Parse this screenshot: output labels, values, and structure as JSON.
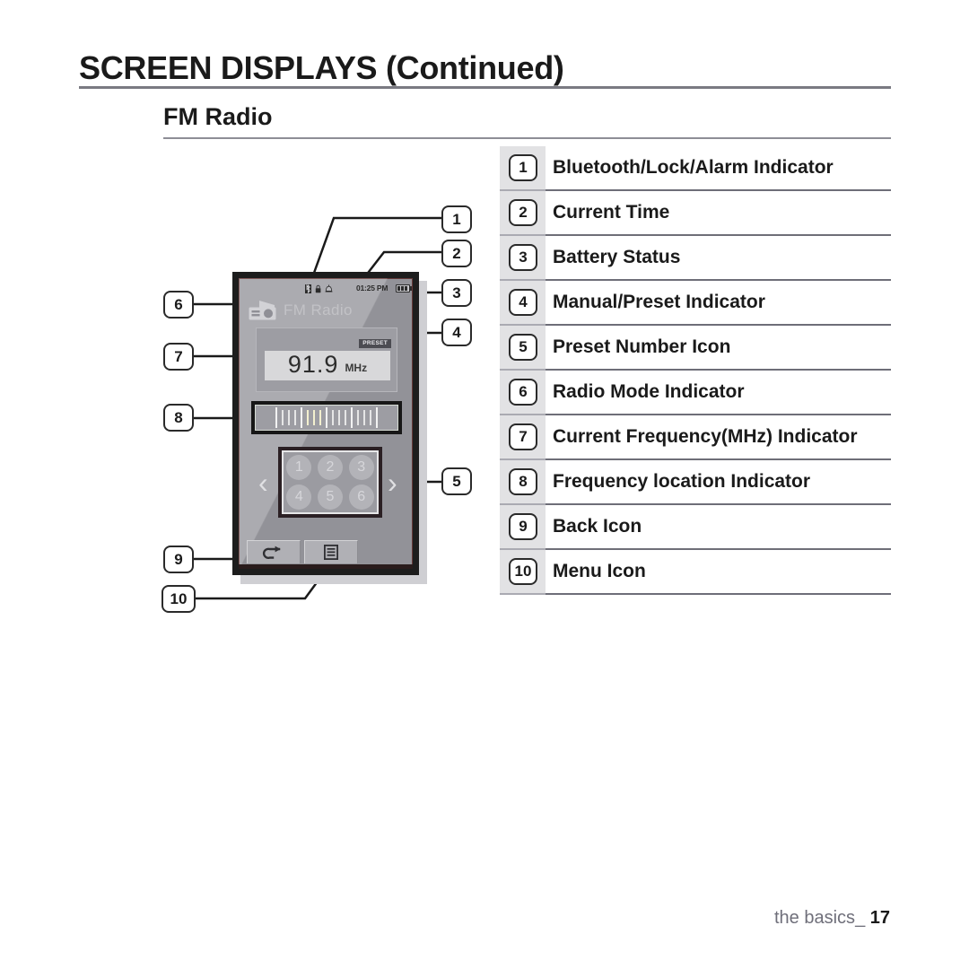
{
  "header": {
    "title": "SCREEN DISPLAYS (Continued)",
    "section": "FM Radio"
  },
  "legend": {
    "items": [
      {
        "num": "1",
        "label": "Bluetooth/Lock/Alarm Indicator"
      },
      {
        "num": "2",
        "label": "Current Time"
      },
      {
        "num": "3",
        "label": "Battery Status"
      },
      {
        "num": "4",
        "label": "Manual/Preset Indicator"
      },
      {
        "num": "5",
        "label": "Preset Number Icon"
      },
      {
        "num": "6",
        "label": "Radio Mode Indicator"
      },
      {
        "num": "7",
        "label": "Current Frequency(MHz) Indicator"
      },
      {
        "num": "8",
        "label": "Frequency location Indicator"
      },
      {
        "num": "9",
        "label": "Back Icon"
      },
      {
        "num": "10",
        "label": "Menu Icon"
      }
    ]
  },
  "callouts": {
    "c1": "1",
    "c2": "2",
    "c3": "3",
    "c4": "4",
    "c5": "5",
    "c6": "6",
    "c7": "7",
    "c8": "8",
    "c9": "9",
    "c10": "10"
  },
  "device": {
    "status_bar": {
      "bluetooth_icon": "bluetooth-icon",
      "lock_icon": "lock-icon",
      "alarm_icon": "alarm-icon",
      "time": "01:25 PM",
      "battery_icon": "battery-icon",
      "battery_bars": 3
    },
    "screen_title": "FM Radio",
    "mode_icon": "radio-icon",
    "preset_badge": "PRESET",
    "frequency": {
      "value": "91.9",
      "unit": "MHz"
    },
    "preset_numbers": [
      "1",
      "2",
      "3",
      "4",
      "5",
      "6"
    ],
    "chevron_left": "‹",
    "chevron_right": "›",
    "back_icon": "back-arrow-icon",
    "menu_icon": "menu-list-icon"
  },
  "footer": {
    "label": "the basics",
    "separator": "_",
    "page": "17"
  },
  "colors": {
    "rule": "#7a7a82",
    "legend_gray": "#e2e2e4",
    "device_body": "#9b9ba1",
    "device_frame": "#1d1d1d",
    "text": "#1a1a1a",
    "footer_label": "#6f6f7a"
  }
}
